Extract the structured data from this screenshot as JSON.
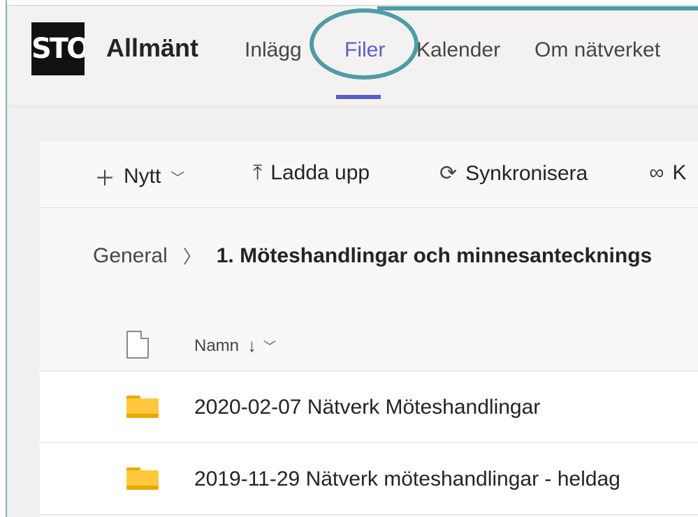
{
  "header": {
    "logo_text": "STO",
    "channel_title": "Allmänt",
    "tabs": [
      {
        "label": "Inlägg"
      },
      {
        "label": "Filer"
      },
      {
        "label": "Kalender"
      },
      {
        "label": "Om nätverket"
      }
    ],
    "active_tab": "Filer"
  },
  "toolbar": {
    "new_label": "Nytt",
    "upload_label": "Ladda upp",
    "sync_label": "Synkronisera",
    "copy_link_label": "K"
  },
  "breadcrumb": {
    "root": "General",
    "current": "1. Möteshandlingar och minnesantecknings"
  },
  "list": {
    "column_name": "Namn",
    "sort_direction": "descending",
    "rows": [
      {
        "name": "2020-02-07 Nätverk Möteshandlingar",
        "type": "folder"
      },
      {
        "name": "2019-11-29 Nätverk möteshandlingar - heldag",
        "type": "folder"
      }
    ]
  },
  "colors": {
    "accent": "#5b5fc7",
    "callout": "#4d9ca8",
    "folder": "#ffc83d"
  }
}
